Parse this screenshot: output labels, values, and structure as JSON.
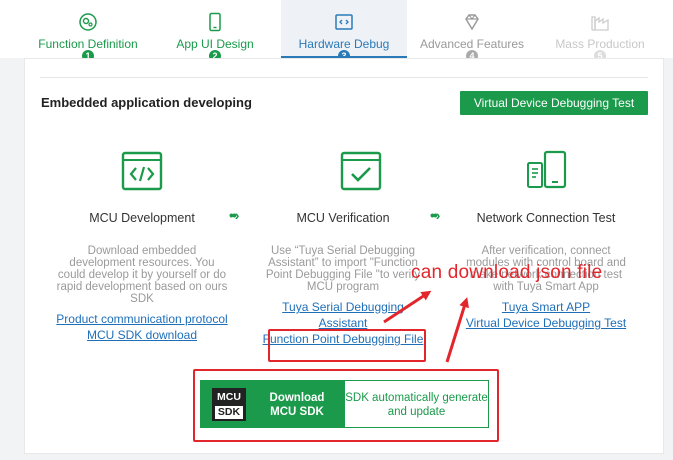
{
  "steps": [
    {
      "label": "Function Definition",
      "number": "1",
      "state": "done",
      "icon": "function-settings-icon"
    },
    {
      "label": "App UI Design",
      "number": "2",
      "state": "done",
      "icon": "phone-icon"
    },
    {
      "label": "Hardware Debug",
      "number": "3",
      "state": "active",
      "icon": "code-window-icon"
    },
    {
      "label": "Advanced Features",
      "number": "4",
      "state": "todo",
      "icon": "diamond-icon"
    },
    {
      "label": "Mass Production",
      "number": "5",
      "state": "disabled",
      "icon": "factory-icon"
    }
  ],
  "card": {
    "title": "Embedded application developing",
    "virtual_debug_button": "Virtual Device Debugging Test"
  },
  "columns": [
    {
      "title": "MCU Development",
      "icon": "code-window-icon",
      "description": "Download embedded development resources. You could develop it by yourself or do rapid development based on ours SDK",
      "links": [
        "Product communication protocol",
        "MCU SDK download"
      ]
    },
    {
      "title": "MCU Verification",
      "icon": "checkbox-window-icon",
      "description": "Use “Tuya Serial Debugging Assistant” to import \"Function Point Debugging File \"to verify MCU program",
      "links": [
        "Tuya Serial Debugging Assistant",
        "Function Point Debugging File"
      ]
    },
    {
      "title": "Network Connection Test",
      "icon": "devices-icon",
      "description": "After verification, connect modules with control board and make network connection test with Tuya Smart App",
      "links": [
        "Tuya Smart APP",
        "Virtual Device Debugging Test"
      ]
    }
  ],
  "arrow_glyph": "••›",
  "download": {
    "logo_top": "MCU",
    "logo_bottom": "SDK",
    "primary_label": "Download MCU SDK",
    "secondary_label": "SDK automatically generate and update"
  },
  "annotation": {
    "text": "can download json file",
    "color": "#e3262b"
  },
  "colors": {
    "brand_green": "#1a9a4a",
    "active_blue": "#2a7ab8",
    "link_blue": "#1f6fb8"
  }
}
